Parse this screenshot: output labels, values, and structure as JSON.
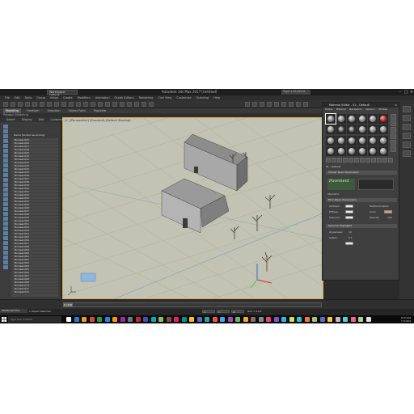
{
  "window": {
    "title": "Autodesk 3ds Max 2017    [Untitled]",
    "workspace": "Workspace: Default",
    "search_placeholder": "Type a keyword"
  },
  "menus": [
    "File",
    "Edit",
    "Tools",
    "Group",
    "Views",
    "Create",
    "Modifiers",
    "Animation",
    "Graph Editors",
    "Rendering",
    "Civil View",
    "Customize",
    "Scripting",
    "Help"
  ],
  "ribbon": {
    "tabs": [
      "Modeling",
      "Freeform",
      "Selection",
      "Object Paint",
      "Populate"
    ],
    "active": "Modeling",
    "sub": "Polygon Modeling"
  },
  "scene_explorer": {
    "tabs": [
      "Select",
      "Display",
      "Edit",
      "Customize"
    ],
    "header": "Name (Sorted Ascending)",
    "rows": [
      "Boolean025",
      "Boolean026",
      "Boolean027",
      "Boolean028",
      "Boolean029",
      "Boolean030",
      "Boolean031",
      "Boolean032",
      "Boolean033",
      "Boolean034",
      "Boolean035",
      "Boolean036",
      "Boolean037",
      "Boolean038",
      "Boolean039",
      "Boolean040",
      "Boolean041",
      "Boolean042",
      "Boolean043",
      "Boolean044",
      "Boolean045",
      "Boolean046",
      "Boolean047",
      "Boolean048",
      "Boolean049",
      "Boolean050",
      "Boolean051",
      "Boolean052",
      "Boolean053",
      "Boolean054",
      "Boolean055",
      "Boolean056",
      "Boolean057",
      "Boolean058",
      "Boolean059",
      "Boolean060",
      "Boolean061",
      "Boolean062",
      "Boolean063",
      "Boolean064",
      "Boolean065",
      "Boolean066",
      "Boolean067",
      "Boolean068",
      "Boolean069",
      "Boolean070",
      "Boolean071",
      "Boolean072"
    ]
  },
  "viewport": {
    "label": "[+] [Perspective] [Standard] [Default Shading]"
  },
  "material_editor": {
    "title": "Material Editor - 01 - Default",
    "menu": [
      "Modes",
      "Material",
      "Navigation",
      "Options",
      "Utilities"
    ],
    "slot_name": "01 - Default",
    "material_type": "Standard",
    "rollouts": {
      "shader": "Shader Basic Parameters",
      "blinn": "Blinn Basic Parameters",
      "self_illum": "Self-Illumination",
      "specular": "Specular Highlights"
    },
    "labels": {
      "ambient": "Ambient:",
      "diffuse": "Diffuse:",
      "specular": "Specular:",
      "opacity": "Opacity:",
      "color": "Color",
      "glossiness": "Glossiness:",
      "soften": "Soften:"
    },
    "values": {
      "opacity": "100",
      "glossiness": "10",
      "soften": "0.1"
    },
    "swatch_label": "Pavement"
  },
  "timeline": {
    "frame": "0 / 100"
  },
  "status": {
    "maxscript": "MAXScript Mini",
    "message": "1 Object Selected",
    "hint": "Click or click-and-drag to select objects",
    "x_label": "X:",
    "y_label": "Y:",
    "z_label": "Z:",
    "grid": "Grid = 10.0"
  },
  "taskbar": {
    "search_placeholder": "Type here to search",
    "time": "10:45 AM",
    "date": "7/11/2019"
  },
  "colors": {
    "viewport_bg": "#c2c3b2",
    "selection_border": "#d4b64b",
    "scene_list_bg": "#474747"
  }
}
